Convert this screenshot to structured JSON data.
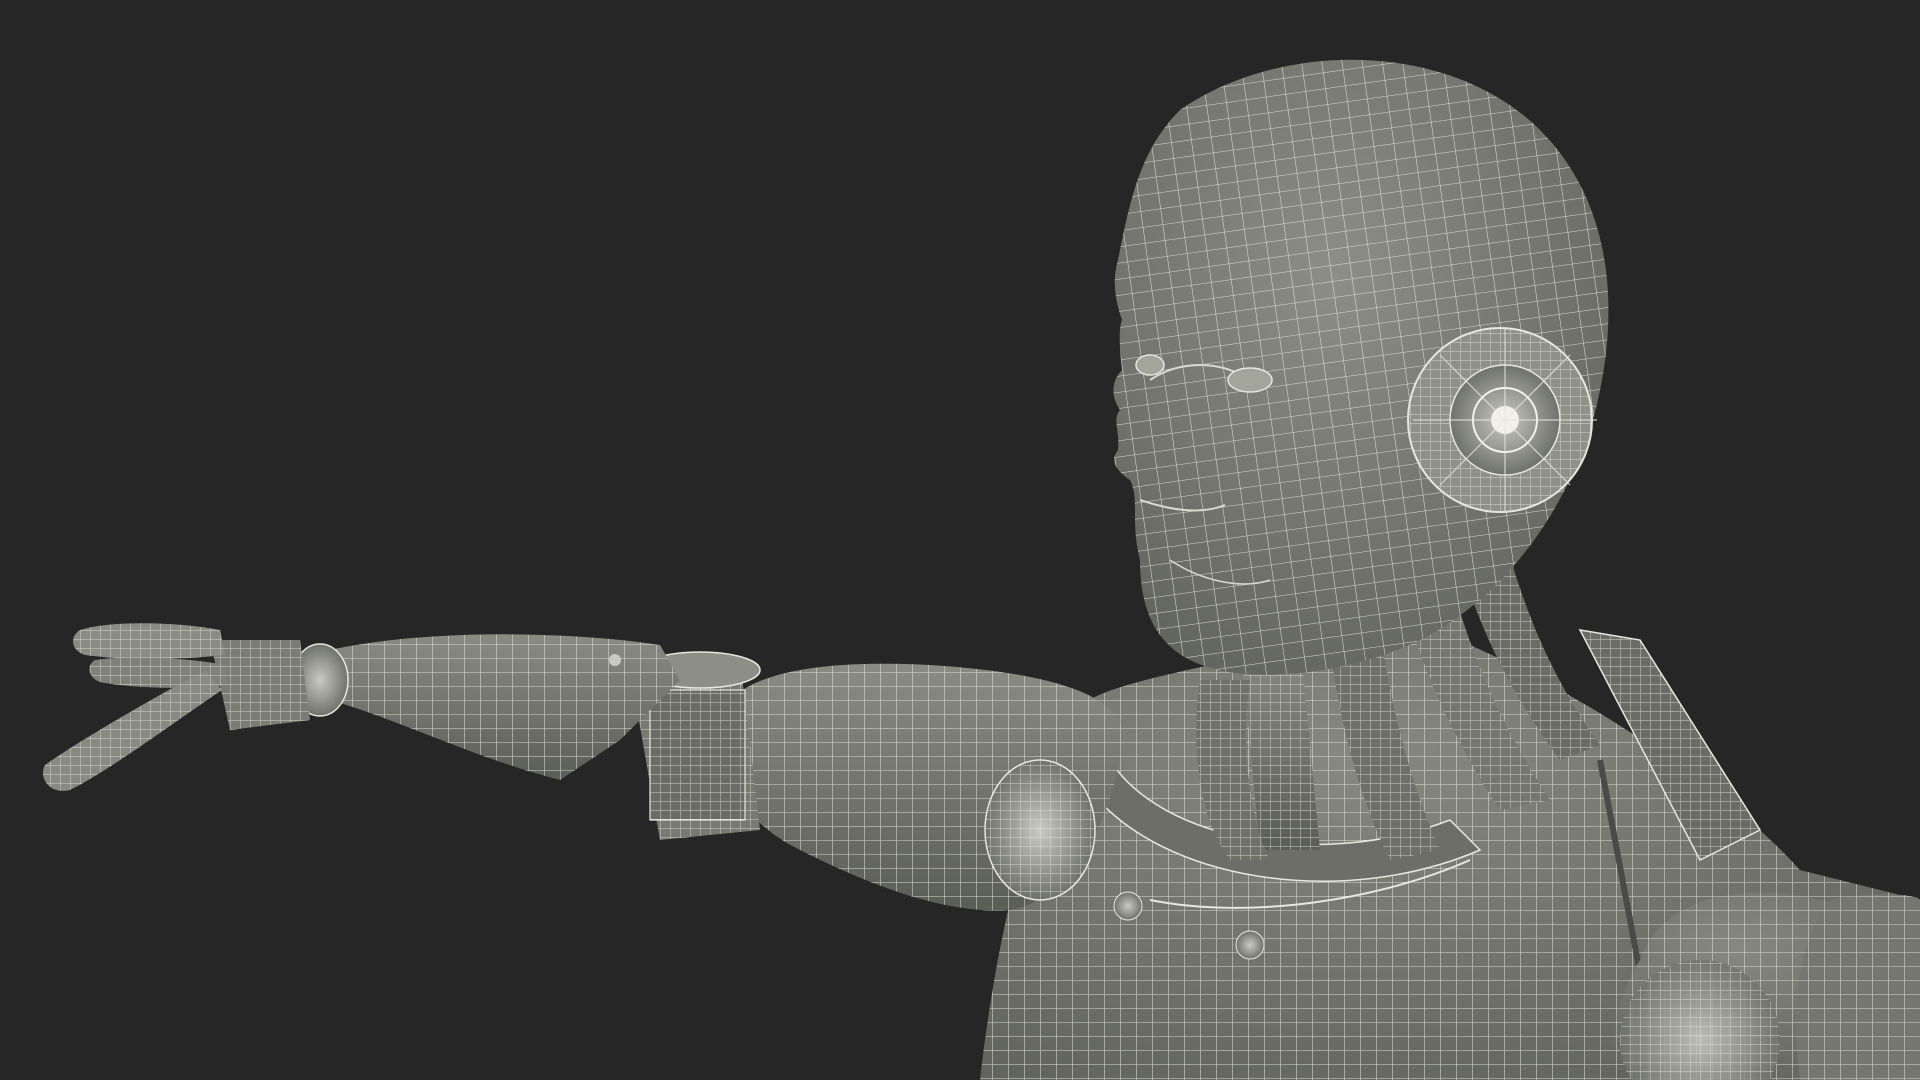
{
  "scene": {
    "background": "#262626",
    "surface": "#7d7f76",
    "surface_shadow": "#5e605a",
    "surface_light": "#9b9d93",
    "wire": "#e7e7df"
  }
}
